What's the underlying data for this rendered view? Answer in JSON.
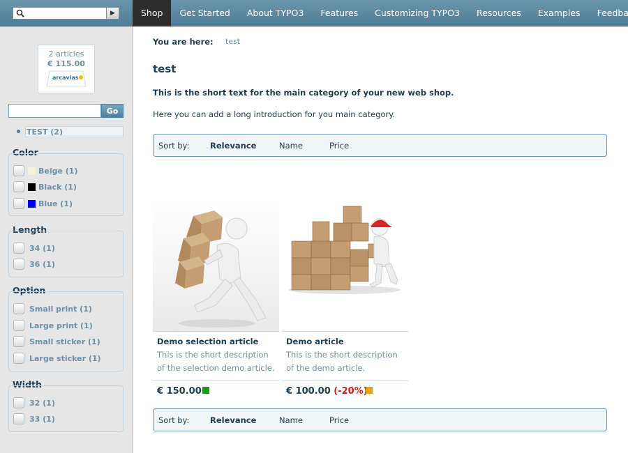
{
  "topbar": {
    "search_icon": "search-icon",
    "submit_arrow": "▶",
    "nav": [
      {
        "label": "Shop",
        "active": true
      },
      {
        "label": "Get Started",
        "active": false
      },
      {
        "label": "About TYPO3",
        "active": false
      },
      {
        "label": "Features",
        "active": false
      },
      {
        "label": "Customizing TYPO3",
        "active": false
      },
      {
        "label": "Resources",
        "active": false
      },
      {
        "label": "Examples",
        "active": false
      },
      {
        "label": "Feedback",
        "active": false
      }
    ]
  },
  "sidebar": {
    "basket": {
      "count": "2 articles",
      "total": "€ 115.00",
      "logo_text": "arcavias"
    },
    "search": {
      "value": "",
      "button": "Go"
    },
    "category": {
      "label": "TEST (2)"
    },
    "facets": [
      {
        "title": "Color",
        "options": [
          {
            "label": "Beige (1)",
            "swatch": "#f3f3dc"
          },
          {
            "label": "Black (1)",
            "swatch": "#000000"
          },
          {
            "label": "Blue (1)",
            "swatch": "#0000ff"
          }
        ]
      },
      {
        "title": "Length",
        "options": [
          {
            "label": "34 (1)"
          },
          {
            "label": "36 (1)"
          }
        ]
      },
      {
        "title": "Option",
        "options": [
          {
            "label": "Small print (1)"
          },
          {
            "label": "Large print (1)"
          },
          {
            "label": "Small sticker (1)"
          },
          {
            "label": "Large sticker (1)"
          }
        ]
      },
      {
        "title": "Width",
        "options": [
          {
            "label": "32 (1)"
          },
          {
            "label": "33 (1)"
          }
        ]
      }
    ]
  },
  "main": {
    "breadcrumb": {
      "label": "You are here:",
      "link": "test"
    },
    "title": "test",
    "short_text": "This is the short text for the main category of your new web shop.",
    "long_text": "Here you can add a long introduction for you main category.",
    "sort": {
      "label": "Sort by:",
      "relevance": "Relevance",
      "name": "Name",
      "price": "Price"
    },
    "products": [
      {
        "name": "Demo selection article",
        "desc": "This is the short description of the selection demo article.",
        "price": "€ 150.00",
        "rebate": "",
        "stock_color": "#1a9a1a"
      },
      {
        "name": "Demo article",
        "desc": "This is the short description of the demo article.",
        "price": "€ 100.00",
        "rebate": "(-20%)",
        "stock_color": "#f0a000"
      }
    ]
  }
}
